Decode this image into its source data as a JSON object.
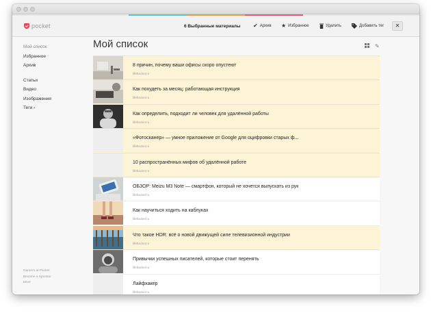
{
  "app": {
    "logo_text": "pocket"
  },
  "colors": {
    "accent": "#ef4056",
    "selected_row": "#fdf4d7",
    "colorline": [
      "#e8e8e8",
      "#e8e8e8",
      "#62c3cf",
      "#d9a44b",
      "#e25f75",
      "#e8e8e8",
      "#e8e8e8"
    ]
  },
  "topbar": {
    "selection_count": "6 Выбранные материалы",
    "actions": [
      {
        "label": "Архив",
        "icon": "check-icon"
      },
      {
        "label": "Избранное",
        "icon": "star-icon"
      },
      {
        "label": "Удалить",
        "icon": "trash-icon"
      },
      {
        "label": "Добавить тег",
        "icon": "tag-icon"
      }
    ],
    "close_icon": "close-icon"
  },
  "sidebar": {
    "primary": [
      {
        "label": "Мой список",
        "active": true
      },
      {
        "label": "Избранное",
        "active": false
      },
      {
        "label": "Архив",
        "active": false
      }
    ],
    "secondary": [
      {
        "label": "Статьи"
      },
      {
        "label": "Видео"
      },
      {
        "label": "Изображения"
      },
      {
        "label": "Теги ›"
      }
    ],
    "footer": [
      "Careers at Pocket",
      "Become a Sponsor",
      "More"
    ]
  },
  "main": {
    "title": "Мой список"
  },
  "items": [
    {
      "title": "8 причин, почему ваши офисы скоро опустеют",
      "domain": "lifehacker.ru",
      "selected": true,
      "thumb": "office"
    },
    {
      "title": "Как похудеть за месяц: работающая инструкция",
      "domain": "lifehacker.ru",
      "selected": true,
      "thumb": "diet"
    },
    {
      "title": "Как определить, подходит ли человек для удалённой работы",
      "domain": "lifehacker.ru",
      "selected": true,
      "thumb": "portrait"
    },
    {
      "title": "«Фотосканер» — умное приложение от Google для оцифровки старых ф...",
      "domain": "lifehacker.ru",
      "selected": true,
      "thumb": "none"
    },
    {
      "title": "10 распространённых мифов об удалённой работе",
      "domain": "lifehacker.ru",
      "selected": true,
      "thumb": "none"
    },
    {
      "title": "ОБЗОР: Meizu M3 Note — смартфон, который не хочется выпускать из рук",
      "domain": "lifehacker.ru",
      "selected": false,
      "thumb": "phone"
    },
    {
      "title": "Как научиться ходить на каблуках",
      "domain": "lifehacker.ru",
      "selected": false,
      "thumb": "heels"
    },
    {
      "title": "Что такое HDR: всё о новой движущей силе телевизионной индустрии",
      "domain": "lifehacker.ru",
      "selected": true,
      "thumb": "hdr"
    },
    {
      "title": "Привычки успешных писателей, которые стоит перенять",
      "domain": "lifehacker.ru",
      "selected": false,
      "thumb": "writer"
    },
    {
      "title": "Лайфхакер",
      "domain": "lifehacker.ru",
      "selected": false,
      "thumb": "none"
    }
  ]
}
